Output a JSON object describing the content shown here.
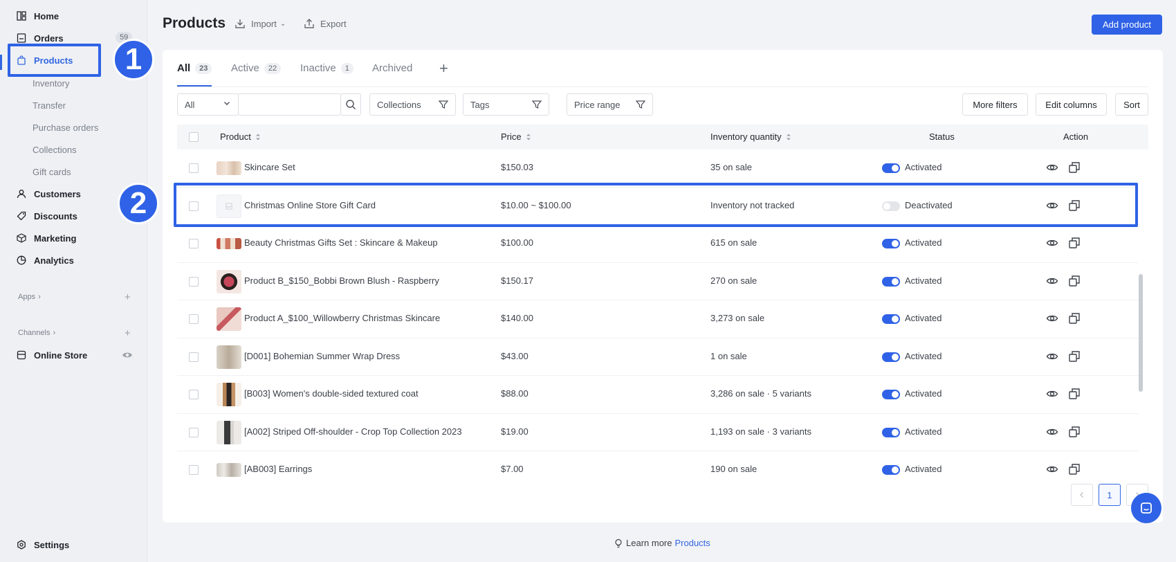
{
  "sidebar": {
    "home": "Home",
    "orders": "Orders",
    "orders_count": "59",
    "products": "Products",
    "sub": [
      "Inventory",
      "Transfer",
      "Purchase orders",
      "Collections",
      "Gift cards"
    ],
    "customers": "Customers",
    "discounts": "Discounts",
    "marketing": "Marketing",
    "analytics": "Analytics",
    "apps": "Apps",
    "channels": "Channels",
    "online_store": "Online Store",
    "settings": "Settings"
  },
  "annotations": {
    "step1": "1",
    "step2": "2",
    "accent": "#2f62e6"
  },
  "header": {
    "title": "Products",
    "import": "Import",
    "export": "Export",
    "add": "Add product"
  },
  "tabs": [
    {
      "label": "All",
      "count": "23"
    },
    {
      "label": "Active",
      "count": "22"
    },
    {
      "label": "Inactive",
      "count": "1"
    },
    {
      "label": "Archived"
    }
  ],
  "filters": {
    "scope": "All",
    "search_placeholder": "",
    "collections": "Collections",
    "tags": "Tags",
    "price_range": "Price range",
    "more_filters": "More filters",
    "edit_columns": "Edit columns",
    "sort": "Sort"
  },
  "columns": {
    "product": "Product",
    "price": "Price",
    "inventory": "Inventory quantity",
    "status": "Status",
    "action": "Action"
  },
  "rows": [
    {
      "name": "Skincare Set",
      "price": "$150.03",
      "inventory": "35 on sale",
      "status": "Activated",
      "active": true
    },
    {
      "name": "Christmas Online Store Gift Card",
      "price": "$10.00 ~ $100.00",
      "inventory": "Inventory not tracked",
      "status": "Deactivated",
      "active": false
    },
    {
      "name": "Beauty Christmas Gifts Set : Skincare & Makeup",
      "price": "$100.00",
      "inventory": "615 on sale",
      "status": "Activated",
      "active": true
    },
    {
      "name": "Product B_$150_Bobbi Brown Blush - Raspberry",
      "price": "$150.17",
      "inventory": "270 on sale",
      "status": "Activated",
      "active": true
    },
    {
      "name": "Product A_$100_Willowberry Christmas Skincare",
      "price": "$140.00",
      "inventory": "3,273 on sale",
      "status": "Activated",
      "active": true
    },
    {
      "name": "[D001] Bohemian Summer Wrap Dress",
      "price": "$43.00",
      "inventory": "1 on sale",
      "status": "Activated",
      "active": true
    },
    {
      "name": "[B003] Women's double-sided textured coat",
      "price": "$88.00",
      "inventory": "3,286 on sale · 5 variants",
      "status": "Activated",
      "active": true
    },
    {
      "name": "[A002] Striped Off-shoulder - Crop Top Collection 2023",
      "price": "$19.00",
      "inventory": "1,193 on sale · 3 variants",
      "status": "Activated",
      "active": true
    },
    {
      "name": "[AB003] Earrings",
      "price": "$7.00",
      "inventory": "190 on sale",
      "status": "Activated",
      "active": true
    }
  ],
  "pagination": {
    "current": "1"
  },
  "footer": {
    "text": "Learn more",
    "link": "Products"
  }
}
